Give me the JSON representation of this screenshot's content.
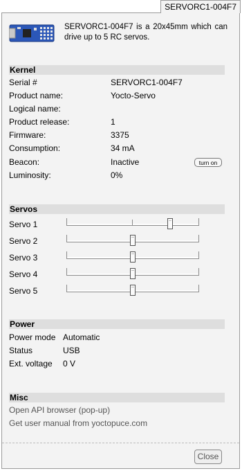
{
  "window": {
    "title": "SERVORC1-004F7"
  },
  "header": {
    "description": "SERVORC1-004F7 is a 20x45mm which can drive up to 5 RC servos."
  },
  "kernel": {
    "title": "Kernel",
    "rows": [
      {
        "label": "Serial #",
        "value": "SERVORC1-004F7"
      },
      {
        "label": "Product name:",
        "value": "Yocto-Servo"
      },
      {
        "label": "Logical name:",
        "value": ""
      },
      {
        "label": "Product release:",
        "value": "1"
      },
      {
        "label": "Firmware:",
        "value": "3375"
      },
      {
        "label": "Consumption:",
        "value": "34 mA"
      },
      {
        "label": "Beacon:",
        "value": "Inactive"
      },
      {
        "label": "Luminosity:",
        "value": "0%"
      }
    ],
    "beacon_button": "turn on"
  },
  "servos": {
    "title": "Servos",
    "items": [
      {
        "label": "Servo 1",
        "position": 0.78
      },
      {
        "label": "Servo 2",
        "position": 0.5
      },
      {
        "label": "Servo 3",
        "position": 0.5
      },
      {
        "label": "Servo 4",
        "position": 0.5
      },
      {
        "label": "Servo 5",
        "position": 0.5
      }
    ]
  },
  "power": {
    "title": "Power",
    "rows": [
      {
        "label": "Power mode",
        "value": "Automatic"
      },
      {
        "label": "Status",
        "value": "USB"
      },
      {
        "label": "Ext. voltage",
        "value": "0 V"
      }
    ]
  },
  "misc": {
    "title": "Misc",
    "links": [
      "Open API browser (pop-up)",
      "Get user manual from yoctopuce.com"
    ]
  },
  "footer": {
    "close_label": "Close"
  }
}
